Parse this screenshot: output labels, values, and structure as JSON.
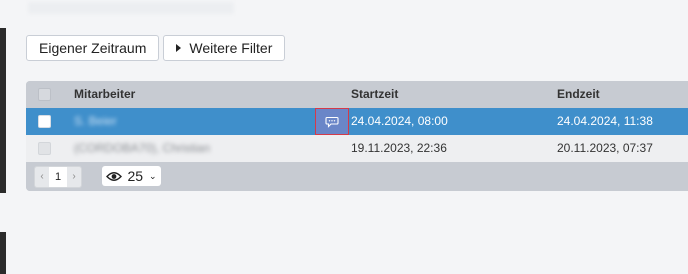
{
  "toolbar": {
    "custom_period_label": "Eigener Zeitraum",
    "more_filters_label": "Weitere Filter"
  },
  "table": {
    "columns": [
      "Mitarbeiter",
      "Startzeit",
      "Endzeit"
    ],
    "rows": [
      {
        "employee": "S. Beier",
        "start": "24.04.2024, 08:00",
        "end": "24.04.2024, 11:38",
        "selected": true,
        "has_comment": true
      },
      {
        "employee": "(CORDOBA70), Christian",
        "start": "19.11.2023, 22:36",
        "end": "20.11.2023, 07:37",
        "selected": false,
        "has_comment": false
      }
    ]
  },
  "pagination": {
    "prev": "‹",
    "current_page": "1",
    "next": "›",
    "page_size": "25"
  },
  "icons": {
    "comment": "comment-icon",
    "eye": "eye-icon",
    "chevron": "chevron-down-icon",
    "caret": "caret-right-icon"
  },
  "colors": {
    "selected_row": "#3f8fcb",
    "header": "#c7cbd2",
    "comment_border": "#d43a4a"
  }
}
